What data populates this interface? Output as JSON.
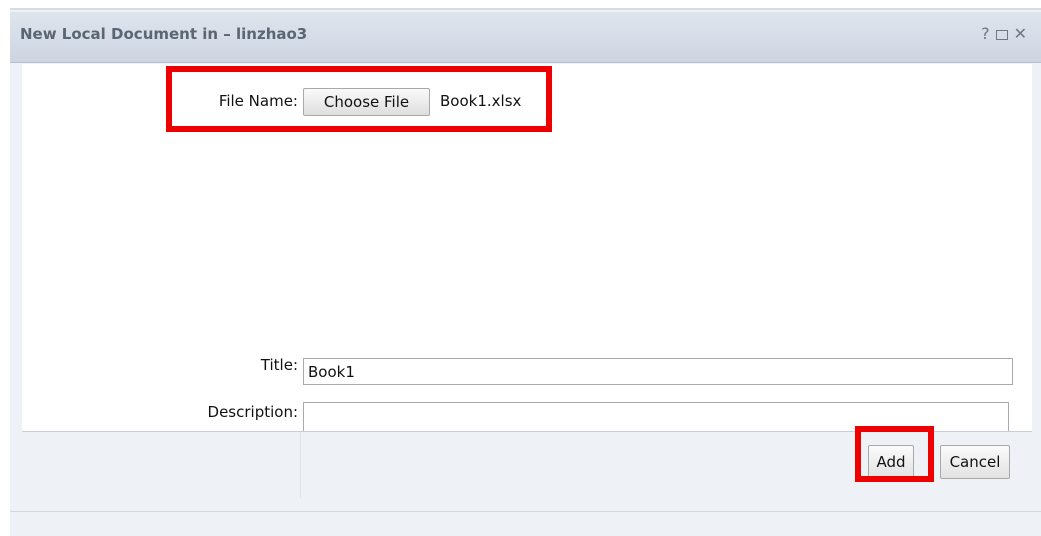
{
  "dialog": {
    "title": "New Local Document in – linzhao3",
    "help_glyph": "?",
    "close_glyph": "✕"
  },
  "form": {
    "file_name_label": "File Name:",
    "choose_file_label": "Choose File",
    "file_name_value": "Book1.xlsx",
    "title_label": "Title:",
    "title_value": "Book1",
    "description_label": "Description:",
    "description_value": ""
  },
  "footer": {
    "add_label": "Add",
    "cancel_label": "Cancel"
  },
  "colors": {
    "highlight": "#ee0000",
    "titlebar": "#d4dbe6"
  }
}
